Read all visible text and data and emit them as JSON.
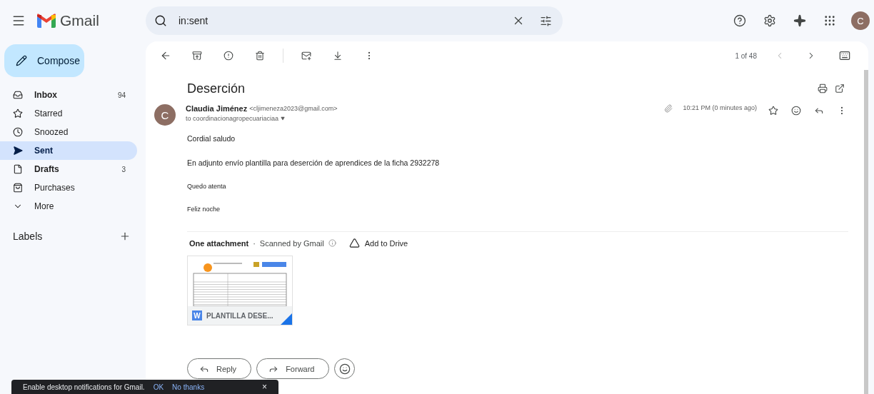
{
  "app": {
    "name": "Gmail",
    "avatar": "C"
  },
  "search": {
    "value": "in:sent"
  },
  "compose": {
    "label": "Compose"
  },
  "sidebar": {
    "items": [
      {
        "kind": "inbox",
        "label": "Inbox",
        "count": "94",
        "bold": true,
        "selected": false
      },
      {
        "kind": "star",
        "label": "Starred",
        "bold": false,
        "selected": false
      },
      {
        "kind": "clock",
        "label": "Snoozed",
        "bold": false,
        "selected": false
      },
      {
        "kind": "send",
        "label": "Sent",
        "bold": true,
        "selected": true
      },
      {
        "kind": "file",
        "label": "Drafts",
        "count": "3",
        "bold": true,
        "selected": false
      },
      {
        "kind": "bag",
        "label": "Purchases",
        "bold": false,
        "selected": false
      },
      {
        "kind": "more",
        "label": "More",
        "bold": false,
        "selected": false
      }
    ],
    "labels_title": "Labels"
  },
  "pager": {
    "text": "1 of 48"
  },
  "message": {
    "subject": "Deserción",
    "sender_name": "Claudia Jiménez",
    "sender_email": "<cljimeneza2023@gmail.com>",
    "to": "to coordinacionagropecuariaciaa",
    "avatar": "C",
    "time": "10:21 PM (0 minutes ago)",
    "starred": false,
    "body": [
      {
        "text": "Cordial saludo"
      },
      {
        "text": "En adjunto envío plantilla para deserción de aprendices de la ficha 2932278"
      },
      {
        "text": "Quedo atenta"
      },
      {
        "text": "Feliz noche"
      }
    ]
  },
  "attachments": {
    "title": "One attachment",
    "separator": "·",
    "scanned": "Scanned by Gmail",
    "add_to_drive": "Add to Drive",
    "files": [
      {
        "badge": "W",
        "name": "PLANTILLA DESE..."
      }
    ]
  },
  "actions": [
    "Reply",
    "Forward"
  ],
  "snackbar": {
    "text": "Enable desktop notifications for Gmail.",
    "ok": "OK",
    "dismiss": "No thanks",
    "close": "×"
  }
}
